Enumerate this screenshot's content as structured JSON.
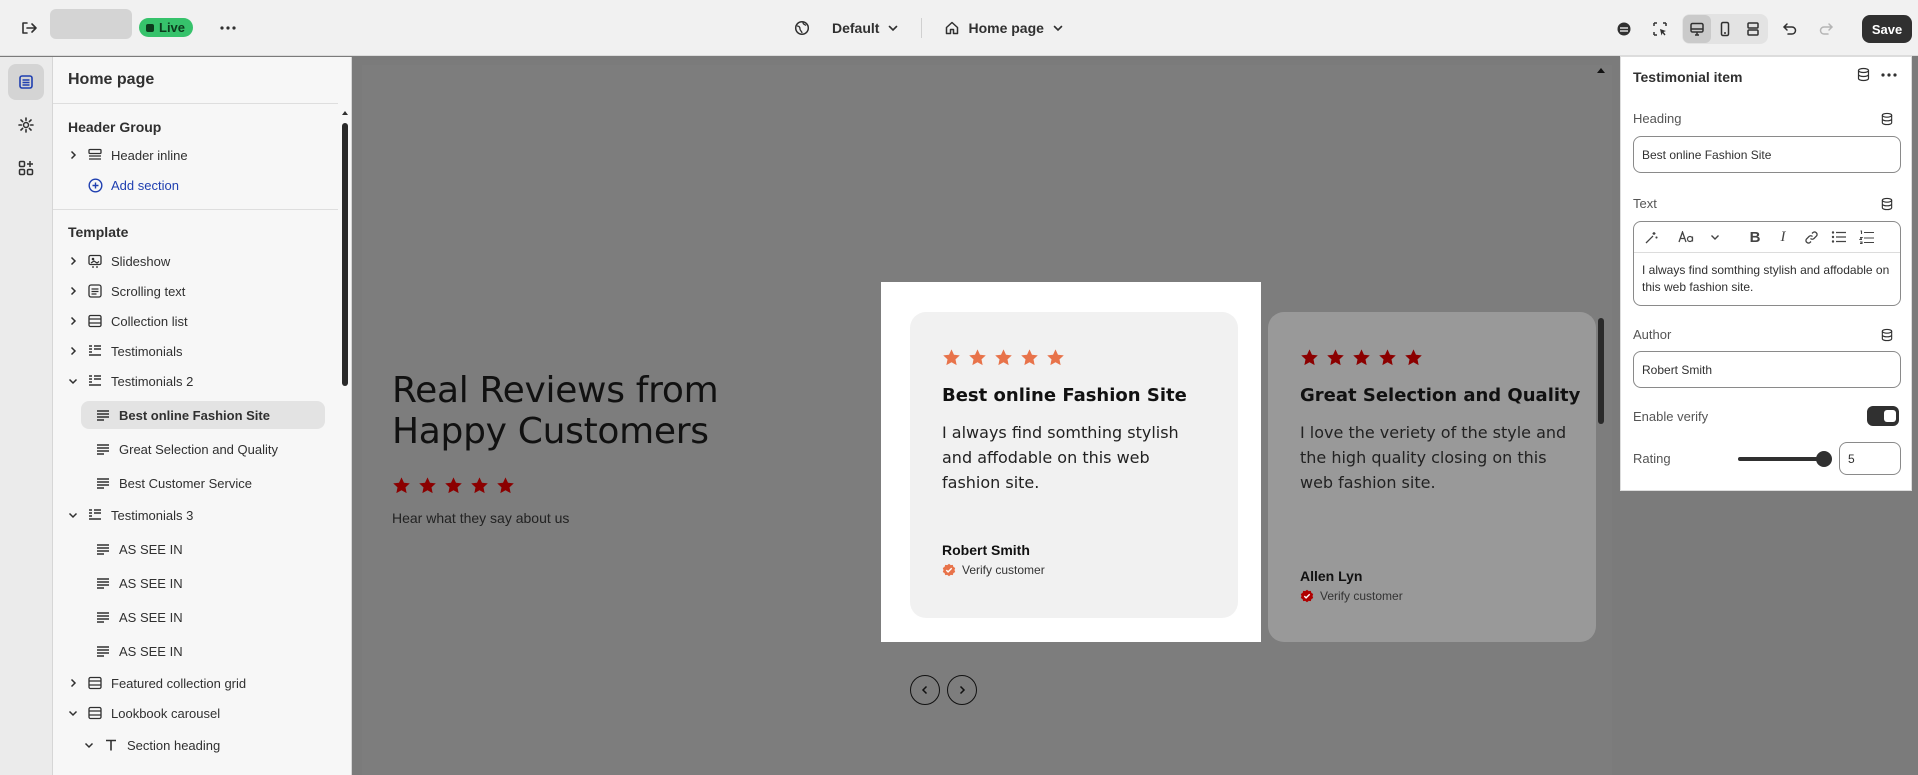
{
  "topbar": {
    "status_badge": "Live",
    "theme_dropdown": "Default",
    "page_dropdown": "Home page",
    "save_label": "Save"
  },
  "sidebar": {
    "title": "Home page",
    "header_group": {
      "label": "Header Group",
      "items": [
        {
          "label": "Header inline",
          "icon": "header-section-icon"
        }
      ],
      "add_label": "Add section"
    },
    "template": {
      "label": "Template",
      "items": [
        {
          "label": "Slideshow",
          "icon": "slideshow-icon"
        },
        {
          "label": "Scrolling text",
          "icon": "text-block-icon"
        },
        {
          "label": "Collection list",
          "icon": "list-icon"
        },
        {
          "label": "Testimonials",
          "icon": "testimonial-icon"
        },
        {
          "label": "Testimonials 2",
          "icon": "testimonial-icon",
          "children": [
            "Best online Fashion Site",
            "Great Selection and Quality",
            "Best Customer Service"
          ]
        },
        {
          "label": "Testimonials 3",
          "icon": "testimonial-icon",
          "children": [
            "AS SEE IN",
            "AS SEE IN",
            "AS SEE IN",
            "AS SEE IN"
          ]
        },
        {
          "label": "Featured collection grid",
          "icon": "list-icon"
        },
        {
          "label": "Lookbook carousel",
          "icon": "list-icon"
        },
        {
          "label": "Section heading",
          "icon": "text-icon"
        }
      ]
    }
  },
  "preview": {
    "heading": "Real Reviews from Happy Customers",
    "subheading": "Hear what they say about us",
    "rating": 5,
    "cards": [
      {
        "title": "Best online Fashion Site",
        "text": "I always find somthing stylish and affodable on this web fashion site.",
        "author": "Robert Smith",
        "verify": "Verify customer",
        "rating": 5,
        "star_color": "#e8734a"
      },
      {
        "title": "Great Selection and Quality",
        "text": "I love the veriety of the style and the high quality closing on this web fashion site.",
        "author": "Allen Lyn",
        "verify": "Verify customer",
        "rating": 5,
        "star_color": "#8b0000"
      }
    ]
  },
  "panel": {
    "title": "Testimonial item",
    "heading_label": "Heading",
    "heading_value": "Best online Fashion Site",
    "text_label": "Text",
    "text_value": "I always find somthing stylish and affodable on this web fashion site.",
    "author_label": "Author",
    "author_value": "Robert Smith",
    "verify_label": "Enable verify",
    "verify_on": true,
    "rating_label": "Rating",
    "rating_value": "5",
    "rating_fraction": 1.0
  },
  "colors": {
    "accent_star": "#e8734a",
    "dark_star": "#8b0000",
    "live_green": "#36c26b"
  }
}
